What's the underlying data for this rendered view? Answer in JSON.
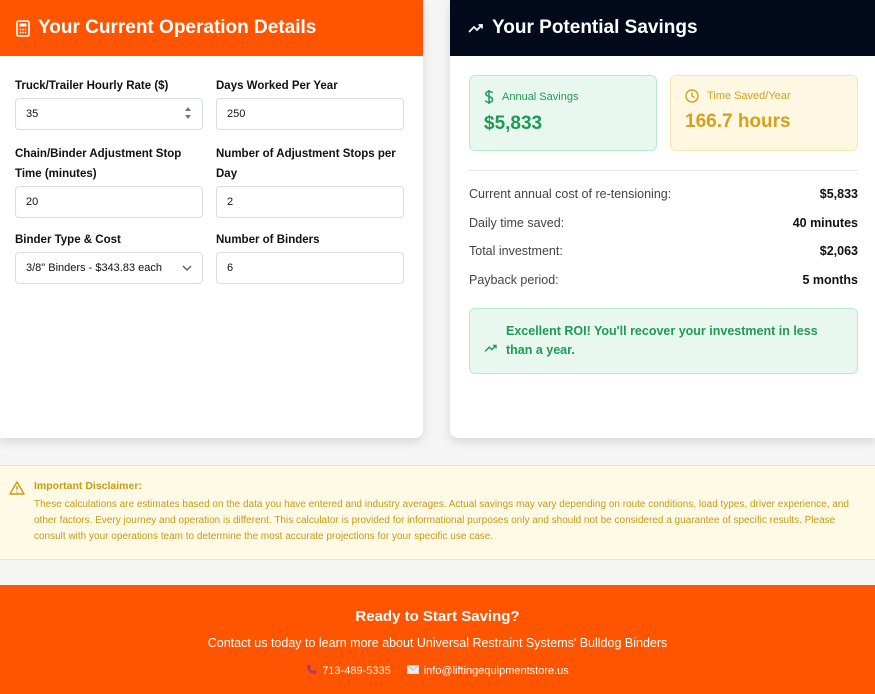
{
  "left_card": {
    "title": "Your Current Operation Details",
    "fields": [
      {
        "label": "Truck/Trailer Hourly Rate ($)",
        "value": "35"
      },
      {
        "label": "Days Worked Per Year",
        "value": "250"
      },
      {
        "label": "Chain/Binder Adjustment Stop Time (minutes)",
        "value": "20"
      },
      {
        "label": "Number of Adjustment Stops per Day",
        "value": "2"
      },
      {
        "label": "Binder Type & Cost",
        "value": "3/8\" Binders - $343.83 each"
      },
      {
        "label": "Number of Binders",
        "value": "6"
      }
    ]
  },
  "right_card": {
    "title": "Your Potential Savings",
    "annual_savings": {
      "label": "Annual Savings",
      "value": "$5,833"
    },
    "time_saved": {
      "label": "Time Saved/Year",
      "value": "166.7 hours"
    },
    "rows": [
      {
        "label": "Current annual cost of re-tensioning:",
        "value": "$5,833"
      },
      {
        "label": "Daily time saved:",
        "value": "40 minutes"
      },
      {
        "label": "Total investment:",
        "value": "$2,063"
      },
      {
        "label": "Payback period:",
        "value": "5 months"
      }
    ],
    "roi_message": "Excellent ROI! You'll recover your investment in less than a year."
  },
  "disclaimer": {
    "title": "Important Disclaimer:",
    "text": "These calculations are estimates based on the data you have entered and industry averages. Actual savings may vary depending on route conditions, load types, driver experience, and other factors. Every journey and operation is different. This calculator is provided for informational purposes only and should not be considered a guarantee of specific results. Please consult with your operations team to determine the most accurate projections for your specific use case."
  },
  "footer": {
    "title": "Ready to Start Saving?",
    "subtitle": "Contact us today to learn more about Universal Restraint Systems' Bulldog Binders",
    "phone": "713-489-5335",
    "email": "info@liftingequipmentstore.us"
  },
  "colors": {
    "orange": "#ff5400",
    "navy": "#020a1b",
    "green": "#1e9a55",
    "yellow": "#d4a21a"
  },
  "icons": [
    "calculator-icon",
    "trending-up-icon",
    "dollar-icon",
    "clock-icon",
    "warning-icon",
    "phone-icon",
    "mail-icon",
    "spinner-arrows-icon",
    "chevron-down-icon"
  ]
}
